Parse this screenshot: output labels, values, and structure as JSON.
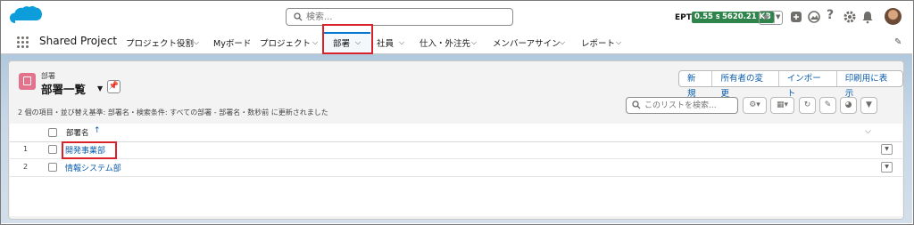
{
  "search": {
    "placeholder": "検索..."
  },
  "perf": {
    "label": "EPT:",
    "ept": "0.55 s",
    "size": "5620.21 KB"
  },
  "nav": {
    "app_name": "Shared Project",
    "items": [
      "プロジェクト役割",
      "Myボード",
      "プロジェクト",
      "部署",
      "社員",
      "仕入・外注先",
      "メンバーアサイン",
      "レポート"
    ],
    "active": "部署"
  },
  "list": {
    "breadcrumb": "部署",
    "title": "部署一覧",
    "buttons": [
      "新規",
      "所有者の変更",
      "インポート",
      "印刷用に表示"
    ],
    "info": "2 個の項目・並び替え基準: 部署名・検索条件: すべての部署 - 部署名・数秒前 に更新されました",
    "search_placeholder": "このリストを検索...",
    "column": "部署名",
    "rows": [
      {
        "num": "1",
        "name": "開発事業部"
      },
      {
        "num": "2",
        "name": "情報システム部"
      }
    ]
  },
  "colors": {
    "brand": "#0176d3",
    "highlight": "#d9222a",
    "badge": "#2e844a",
    "object_icon": "#e3738c"
  }
}
